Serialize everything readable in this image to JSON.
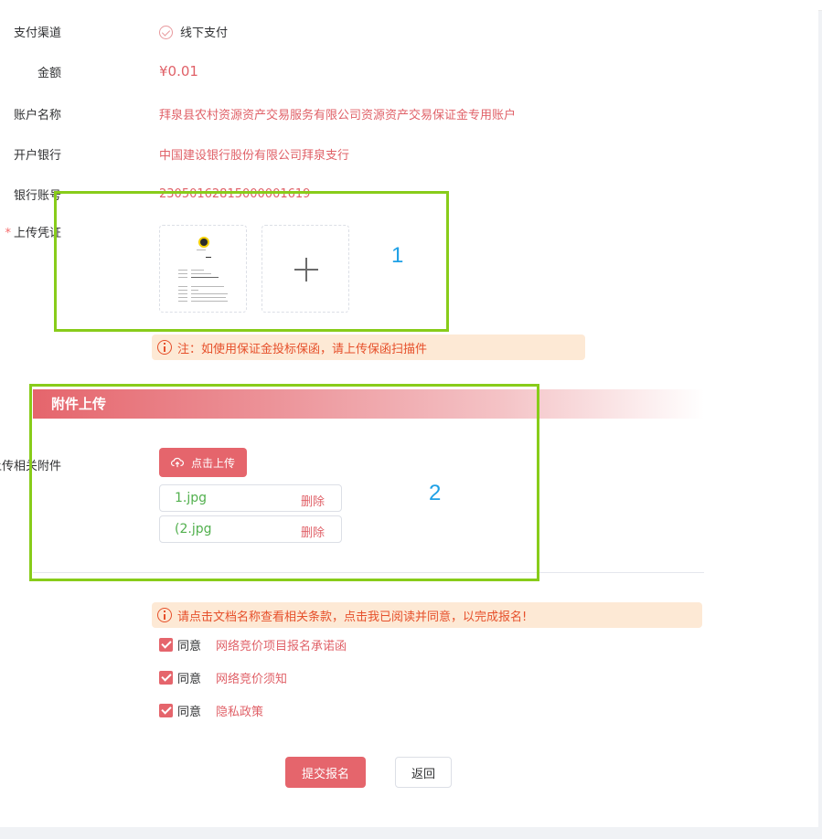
{
  "form": {
    "pay_channel": {
      "label": "支付渠道",
      "value": "线下支付"
    },
    "amount": {
      "label": "金额",
      "value": "¥0.01"
    },
    "account_name": {
      "label": "账户名称",
      "value": "拜泉县农村资源资产交易服务有限公司资源资产交易保证金专用账户"
    },
    "bank": {
      "label": "开户银行",
      "value": "中国建设银行股份有限公司拜泉支行"
    },
    "bank_account": {
      "label": "银行账号",
      "value": "23050162815000001619"
    },
    "voucher": {
      "label": "上传凭证",
      "required_mark": "*"
    },
    "voucher_notice": "注：如使用保证金投标保函，请上传保函扫描件"
  },
  "attachments": {
    "section_title": "附件上传",
    "label": "上传相关附件",
    "upload_button": "点击上传",
    "files": [
      {
        "name": "1.jpg",
        "delete_label": "删除"
      },
      {
        "name": "(2.jpg",
        "delete_label": "删除"
      }
    ]
  },
  "agreement": {
    "notice": "请点击文档名称查看相关条款，点击我已阅读并同意，以完成报名!",
    "items": [
      {
        "agree_label": "同意",
        "doc_name": "网络竞价项目报名承诺函",
        "checked": true
      },
      {
        "agree_label": "同意",
        "doc_name": "网络竞价须知",
        "checked": true
      },
      {
        "agree_label": "同意",
        "doc_name": "隐私政策",
        "checked": true
      }
    ]
  },
  "actions": {
    "submit": "提交报名",
    "back": "返回"
  },
  "annotations": {
    "box1_number": "1",
    "box2_number": "2"
  },
  "colors": {
    "accent": "#e5656c",
    "link": "#e06168",
    "notice_bg": "#fde9d5",
    "notice_text": "#e6502b",
    "annotation_border": "#88cc1a",
    "annotation_number": "#1ea0e6",
    "file_name": "#52b04e"
  }
}
